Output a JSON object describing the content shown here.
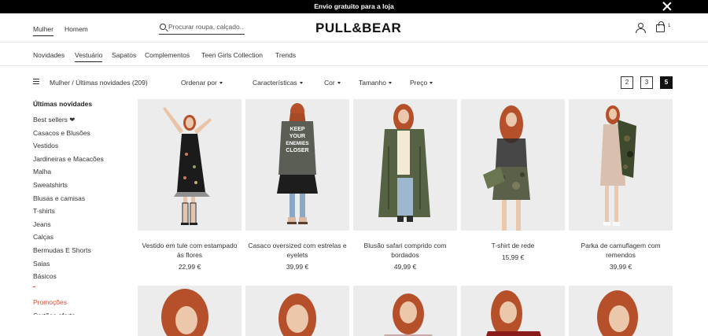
{
  "promo_bar": {
    "text": "Envio gratuito para a loja"
  },
  "header": {
    "gender_tabs": [
      "Mulher",
      "Homem"
    ],
    "search_placeholder": "Procurar roupa, calçado...",
    "logo": "PULL&BEAR",
    "bag_count": "1"
  },
  "categories": [
    "Novidades",
    "Vestuário",
    "Sapatos",
    "Complementos",
    "Teen Girls Collection",
    "Trends"
  ],
  "toolbar": {
    "breadcrumb": "Mulher / Últimas novidades (209)",
    "filters": [
      "Ordenar por",
      "Características",
      "Cor",
      "Tamanho",
      "Preço"
    ],
    "pages": [
      "2",
      "3",
      "5"
    ],
    "active_page": "5"
  },
  "sidebar": {
    "title": "Últimas novidades",
    "items": [
      "Best sellers ❤",
      "Casacos e Blusões",
      "Vestidos",
      "Jardineiras e Macacões",
      "Malha",
      "Sweatshirts",
      "Blusas e camisas",
      "T-shirts",
      "Jeans",
      "Calças",
      "Bermudas E Shorts",
      "Saias",
      "Básicos"
    ],
    "promo": "Promoções",
    "cut_item": "Cartões oferta"
  },
  "products": [
    {
      "name": "Vestido em tule com estampado às flores",
      "price": "22,99 €"
    },
    {
      "name": "Casaco oversized com estrelas e eyelets",
      "price": "39,99 €"
    },
    {
      "name": "Blusão safari comprido com bordados",
      "price": "49,99 €"
    },
    {
      "name": "T-shirt de rede",
      "price": "15,99 €"
    },
    {
      "name": "Parka de camuflagem com remendos",
      "price": "39,99 €"
    }
  ],
  "jacket_text": "KEEP YOUR ENEMIES CLOSER",
  "colors": {
    "promo": "#e24a2f",
    "photo_bg": "#ececec",
    "hair": "#b5502a"
  }
}
